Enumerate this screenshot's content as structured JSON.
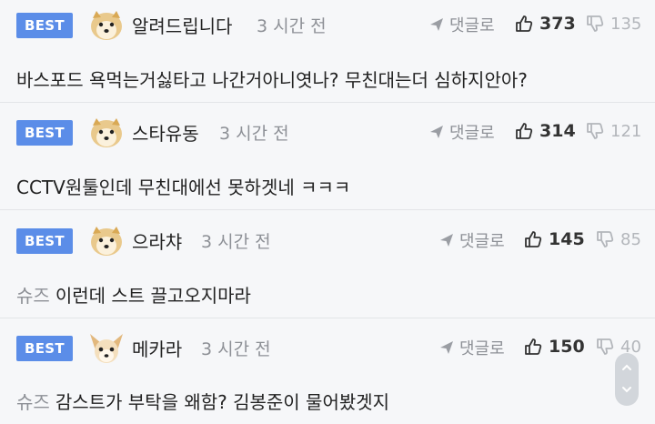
{
  "comments": [
    {
      "badge": "BEST",
      "nickname": "알려드립니다",
      "time": "3 시간 전",
      "reply_label": "댓글로",
      "upvotes": "373",
      "downvotes": "135",
      "prefix": "",
      "text": "바스포드 욕먹는거싫타고 나간거아니엿나? 무친대는더 심하지안아?",
      "avatar_icon": "shiba-dog-avatar-icon"
    },
    {
      "badge": "BEST",
      "nickname": "스타유동",
      "time": "3 시간 전",
      "reply_label": "댓글로",
      "upvotes": "314",
      "downvotes": "121",
      "prefix": "",
      "text": "CCTV원툴인데 무친대에선 못하겟네 ㅋㅋㅋ",
      "avatar_icon": "shiba-dog-avatar-icon"
    },
    {
      "badge": "BEST",
      "nickname": "으라챠",
      "time": "3 시간 전",
      "reply_label": "댓글로",
      "upvotes": "145",
      "downvotes": "85",
      "prefix": "슈즈",
      "text": "이런데 스트 끌고오지마라",
      "avatar_icon": "shiba-dog-avatar-icon"
    },
    {
      "badge": "BEST",
      "nickname": "메카라",
      "time": "3 시간 전",
      "reply_label": "댓글로",
      "upvotes": "150",
      "downvotes": "40",
      "prefix": "슈즈",
      "text": "감스트가 부탁을 왜함? 김봉준이 물어봤겟지",
      "avatar_icon": "chihuahua-avatar-icon"
    }
  ],
  "colors": {
    "badge_bg": "#5b8de8",
    "meta_gray": "#8d9096",
    "downvote_gray": "#b3b6bb",
    "background": "#f6f7f9"
  },
  "icons": {
    "reply": "paper-plane-icon",
    "upvote": "thumbs-up-icon",
    "downvote": "thumbs-down-icon",
    "scroll": "scroll-up-down-icon"
  }
}
